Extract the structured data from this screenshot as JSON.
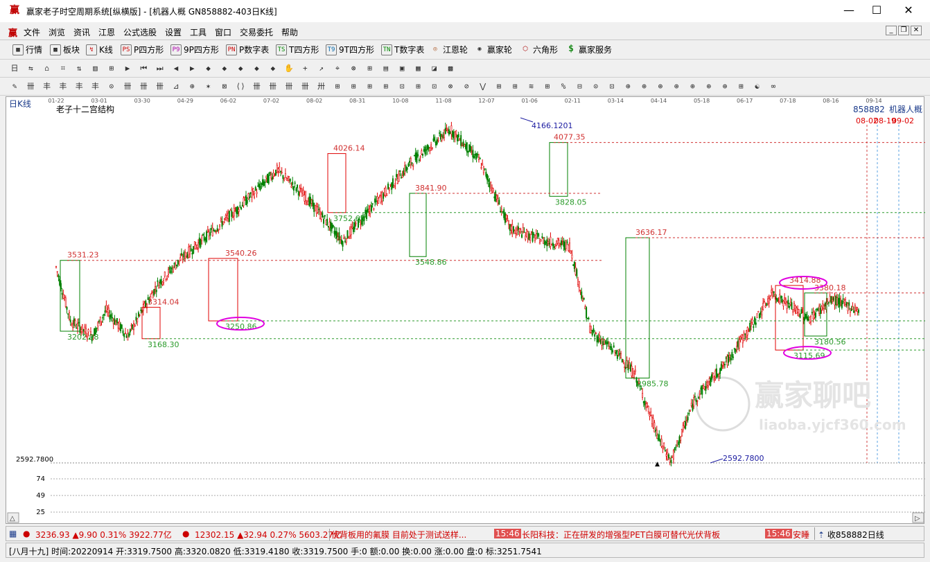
{
  "window": {
    "title": "赢家老子时空周期系统[纵横版] - [机器人概  GN858882-403日K线]",
    "logo": "赢",
    "minimize": "—",
    "maximize": "☐",
    "close": "✕"
  },
  "menu": {
    "logo": "赢",
    "items": [
      "文件",
      "浏览",
      "资讯",
      "江恩",
      "公式选股",
      "设置",
      "工具",
      "窗口",
      "交易委托",
      "帮助"
    ],
    "mdi": [
      "_",
      "❐",
      "✕"
    ]
  },
  "toolbar1": [
    {
      "icon": "grid-icon",
      "glyph": "▦",
      "label": "行情"
    },
    {
      "icon": "blocks-icon",
      "glyph": "▩",
      "label": "板块"
    },
    {
      "icon": "kline-icon",
      "glyph": "↯",
      "label": "K线"
    },
    {
      "icon": "ps-icon",
      "glyph": "PS",
      "label": "P四方形"
    },
    {
      "icon": "p9-icon",
      "glyph": "P9",
      "label": "9P四方形"
    },
    {
      "icon": "pn-icon",
      "glyph": "PN",
      "label": "P数字表"
    },
    {
      "icon": "ts-icon",
      "glyph": "TS",
      "label": "T四方形"
    },
    {
      "icon": "t9-icon",
      "glyph": "T9",
      "label": "9T四方形"
    },
    {
      "icon": "tn-icon",
      "glyph": "TN",
      "label": "T数字表"
    },
    {
      "icon": "gann-wheel-icon",
      "glyph": "◎",
      "label": "江恩轮"
    },
    {
      "icon": "winner-wheel-icon",
      "glyph": "◉",
      "label": "赢家轮"
    },
    {
      "icon": "hexagon-icon",
      "glyph": "⬡",
      "label": "六角形"
    },
    {
      "icon": "dollar-icon",
      "glyph": "$",
      "label": "赢家服务"
    }
  ],
  "toolbar2_icons": [
    "日",
    "⇆",
    "⌂",
    "⌗",
    "⇅",
    "▥",
    "⊞",
    "▶",
    "⏮",
    "⏭",
    "◀",
    "▶",
    "◆",
    "◆",
    "◆",
    "◆",
    "◆",
    "✋",
    "+",
    "↗",
    "⌖",
    "⊛",
    "⊞",
    "▤",
    "▣",
    "▦",
    "◪",
    "▩"
  ],
  "toolbar3_icons": [
    "✎",
    "卌",
    "丰",
    "丰",
    "丰",
    "丰",
    "⊙",
    "卌",
    "卌",
    "卌",
    "⊿",
    "⊕",
    "✶",
    "⊠",
    "⟨⟩",
    "卌",
    "卌",
    "卌",
    "卌",
    "卅",
    "⊞",
    "⊞",
    "⊞",
    "⊞",
    "⊡",
    "⊞",
    "⊡",
    "⊗",
    "⊘",
    "⋁",
    "⊞",
    "⊞",
    "≋",
    "⊞",
    "%",
    "⊟",
    "⊙",
    "⊡",
    "⊕",
    "⊕",
    "⊕",
    "⊕",
    "⊕",
    "⊕",
    "⊕",
    "⊞",
    "☯",
    "∞"
  ],
  "chart": {
    "period_label": "日K线",
    "overlay_title": "老子十二宫结构",
    "code": "858882",
    "name": "机器人概",
    "dates_top": [
      "01-22",
      "03-01",
      "03-30",
      "04-29",
      "06-02",
      "07-02",
      "08-02",
      "08-31",
      "10-08",
      "11-08",
      "12-07",
      "01-06",
      "02-11",
      "03-14",
      "04-14",
      "05-18",
      "06-17",
      "07-18",
      "08-16",
      "09-14"
    ],
    "future_dates": [
      "08-02",
      "08-19",
      "09-02"
    ],
    "low_axis_label": "2592.7800",
    "indicator_ticks": [
      "74",
      "49",
      "25"
    ],
    "levels": {
      "red": [
        {
          "v": 3531.23,
          "label": "3531.23"
        },
        {
          "v": 3540.26,
          "label": "3540.26"
        },
        {
          "v": 3314.04,
          "label": "3314.04"
        },
        {
          "v": 4026.14,
          "label": "4026.14"
        },
        {
          "v": 3841.9,
          "label": "3841.90"
        },
        {
          "v": 4077.35,
          "label": "4077.35"
        },
        {
          "v": 3636.17,
          "label": "3636.17"
        },
        {
          "v": 3414.88,
          "label": "3414.88"
        },
        {
          "v": 3380.18,
          "label": "3380.18"
        }
      ],
      "green": [
        {
          "v": 3202.98,
          "label": "3202.98"
        },
        {
          "v": 3168.3,
          "label": "3168.30"
        },
        {
          "v": 3250.86,
          "label": "3250.86"
        },
        {
          "v": 3752.65,
          "label": "3752.65"
        },
        {
          "v": 3548.86,
          "label": "3548.86"
        },
        {
          "v": 3828.05,
          "label": "3828.05"
        },
        {
          "v": 2985.78,
          "label": "2985.78"
        },
        {
          "v": 3180.56,
          "label": "3180.56"
        },
        {
          "v": 3115.69,
          "label": "3115.69"
        }
      ],
      "high_label": "4166.1201",
      "low_label": "2592.7800"
    },
    "watermark_text": "赢家聊吧",
    "watermark_url": "liaoba.yjcf360.com",
    "colors": {
      "up": "#e00000",
      "down": "#008000",
      "red_line": "#d03030",
      "green_line": "#2a9a2a",
      "ellipse": "#e000e0",
      "blue": "#1a1aa0"
    }
  },
  "status1": {
    "idx1": "3236.93 ▲9.90 0.31% 3922.77亿",
    "idx2": "12302.15 ▲32.94 0.27% 5603.27亿",
    "news1": "伏背板用的氟膜 目前处于测试送样...",
    "time1": "15:46",
    "news2": "长阳科技：正在研发的增强型PET白膜可替代光伏背板",
    "time2": "15:46",
    "news3": "安睡",
    "right": "收858882日线"
  },
  "status2": {
    "text": "[八月十九] 时间:20220914 开:3319.7500 高:3320.0820 低:3319.4180 收:3319.7500 手:0 额:0.00 换:0.00 涨:0.00 盘:0 标:3251.7541"
  }
}
